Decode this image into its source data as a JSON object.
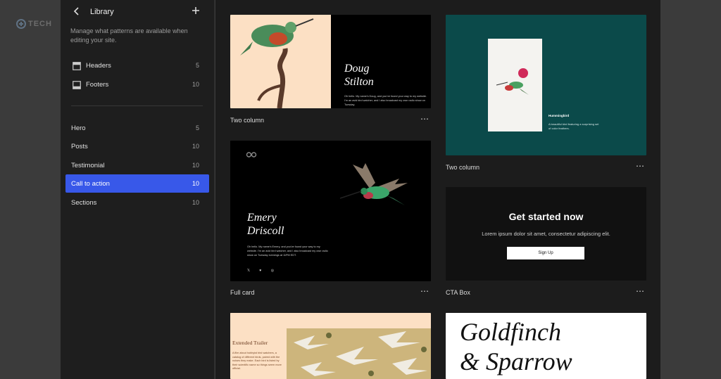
{
  "watermark": {
    "text": "TECH"
  },
  "sidebar": {
    "title": "Library",
    "description": "Manage what patterns are available when editing your site.",
    "primary_items": [
      {
        "label": "Headers",
        "count": "5",
        "icon": "header-layout-icon"
      },
      {
        "label": "Footers",
        "count": "10",
        "icon": "footer-layout-icon"
      }
    ],
    "category_items": [
      {
        "label": "Hero",
        "count": "5",
        "active": false
      },
      {
        "label": "Posts",
        "count": "10",
        "active": false
      },
      {
        "label": "Testimonial",
        "count": "10",
        "active": false
      },
      {
        "label": "Call to action",
        "count": "10",
        "active": true
      },
      {
        "label": "Sections",
        "count": "10",
        "active": false
      }
    ]
  },
  "cards": {
    "two_column_1": {
      "label": "Two column",
      "name": "Doug\nStilton",
      "body": "Oh hello. My name's Doug, and you've found your way to my website. I'm an avid bird watcher, and I also broadcast my own radio show on Tuesday."
    },
    "two_column_2": {
      "label": "Two column",
      "title": "Hummingbird",
      "body": "A beautiful bird featuring a surprising set of color feathers."
    },
    "full_card": {
      "label": "Full card",
      "name": "Emery\nDriscoll",
      "body": "Oh hello. My name's Emery, and you've found your way to my website. I'm an avid bird watcher, and I also broadcast my own radio show on Tuesday evenings at 11PM EDT.",
      "social": "𝕏 ♥ ◎"
    },
    "cta_box": {
      "label": "CTA Box",
      "title": "Get started now",
      "subtitle": "Lorem ipsum dolor sit amet, consectetur adipiscing elit.",
      "button": "Sign Up"
    },
    "extended_trailer": {
      "title": "Extended Trailer",
      "body": "A film about hobbyist bird watchers, a catalog of different birds, paired with the noises they make. Each bird is listed by their scientific name so things seem more official."
    },
    "goldfinch": {
      "title": "Goldfinch\n& Sparrow"
    }
  },
  "colors": {
    "accent": "#3858e9",
    "sidebar_bg": "#1e1e1e",
    "canvas_bg": "#1c1c1c",
    "teal": "#0b4a4a",
    "peach": "#fce0c4"
  }
}
